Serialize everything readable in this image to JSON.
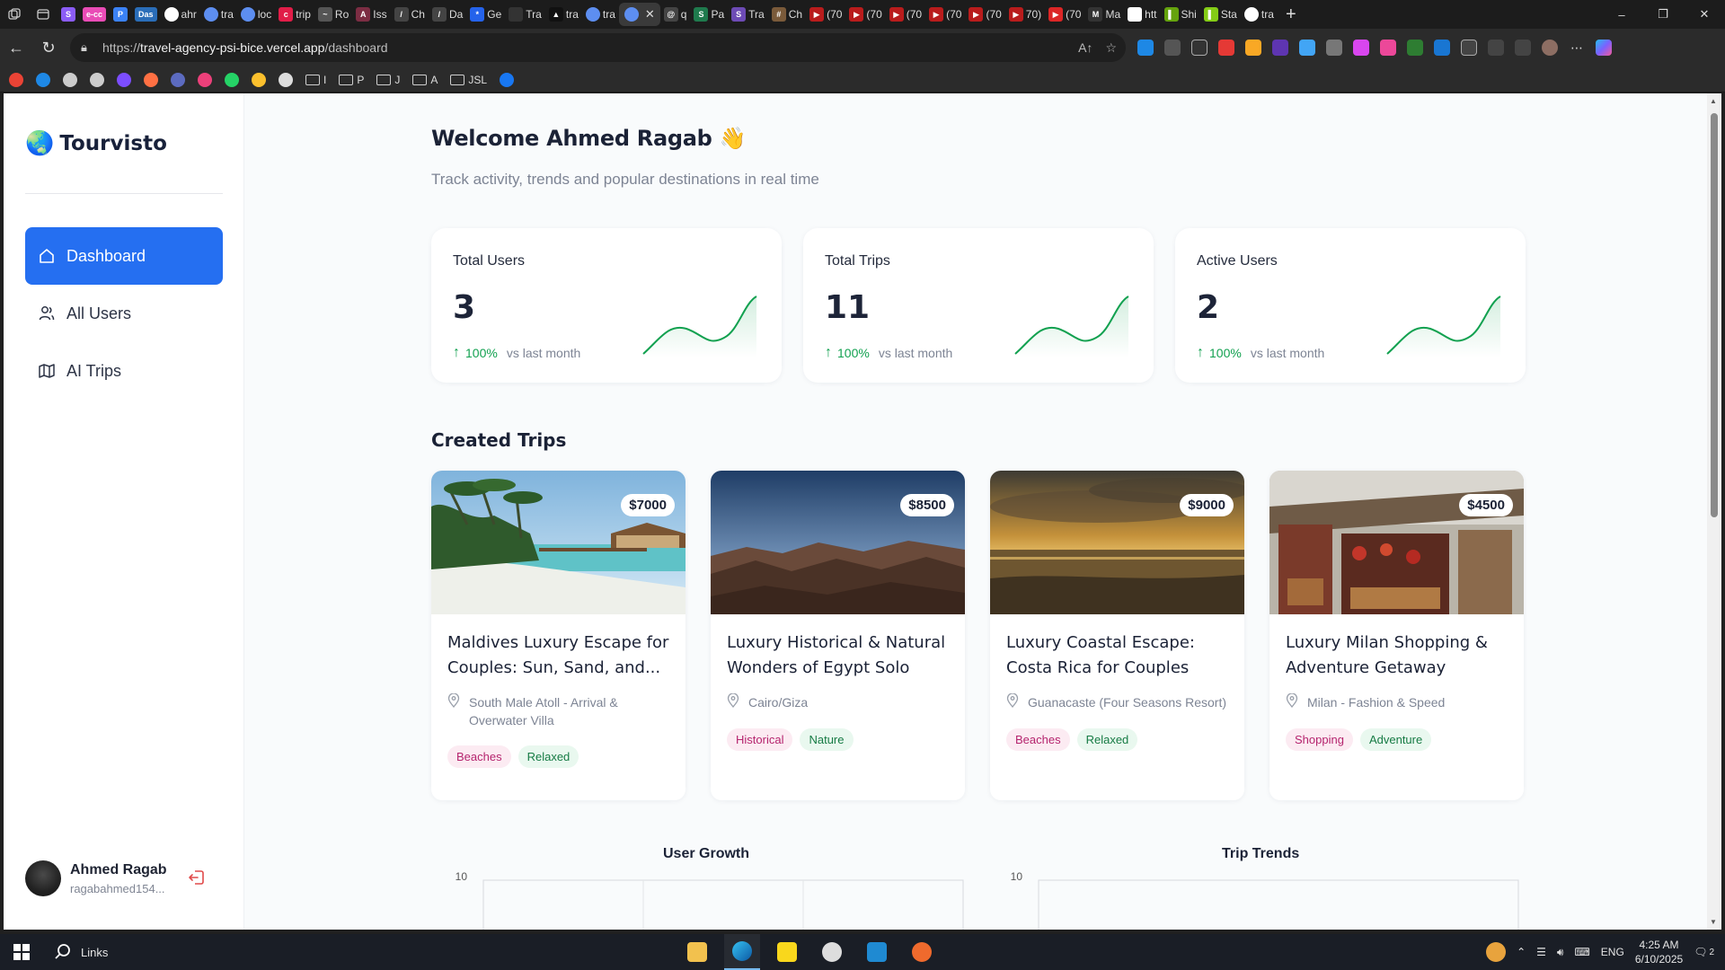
{
  "browser": {
    "tabs": [
      {
        "label": "",
        "favicon": "S",
        "color": "#8b5cf6"
      },
      {
        "label": "",
        "favicon": "e-cc",
        "color": "#e94cb6"
      },
      {
        "label": "",
        "favicon": "P",
        "color": "#3b82f6"
      },
      {
        "label": "",
        "favicon": "Das",
        "color": "#2a6db8"
      },
      {
        "label": "ahr",
        "favicon": "github-icon",
        "color": "#ffffff"
      },
      {
        "label": "tra",
        "favicon": "site-icon",
        "color": "#5d8ef0"
      },
      {
        "label": "loc",
        "favicon": "site-icon",
        "color": "#5d8ef0"
      },
      {
        "label": "trip",
        "favicon": "c",
        "color": "#e11d48"
      },
      {
        "label": "Ro",
        "favicon": "~",
        "color": "#555"
      },
      {
        "label": "Iss",
        "favicon": "A",
        "color": "#7c2d43"
      },
      {
        "label": "Ch",
        "favicon": "/",
        "color": "#444"
      },
      {
        "label": "Da",
        "favicon": "/",
        "color": "#444"
      },
      {
        "label": "Ge",
        "favicon": "*",
        "color": "#2563eb"
      },
      {
        "label": "Tra",
        "favicon": "",
        "color": "#333"
      },
      {
        "label": "tra",
        "favicon": "▲",
        "color": "#111"
      },
      {
        "label": "tra",
        "favicon": "site-icon",
        "color": "#5d8ef0"
      },
      {
        "label": "",
        "favicon": "site-icon",
        "color": "#5d8ef0",
        "active": true
      },
      {
        "label": "q",
        "favicon": "@",
        "color": "#444"
      },
      {
        "label": "Pa",
        "favicon": "S",
        "color": "#1f7a4d"
      },
      {
        "label": "Tra",
        "favicon": "S",
        "color": "#6d4bb5"
      },
      {
        "label": "Ch",
        "favicon": "#",
        "color": "#7a5a3a"
      },
      {
        "label": "(70",
        "favicon": "▶",
        "color": "#b91c1c"
      },
      {
        "label": "(70",
        "favicon": "▶",
        "color": "#b91c1c"
      },
      {
        "label": "(70",
        "favicon": "▶",
        "color": "#b91c1c"
      },
      {
        "label": "(70",
        "favicon": "▶",
        "color": "#b91c1c"
      },
      {
        "label": "(70",
        "favicon": "▶",
        "color": "#b91c1c"
      },
      {
        "label": "70)",
        "favicon": "▶",
        "color": "#b91c1c"
      },
      {
        "label": "(70",
        "favicon": "▶",
        "color": "#dc2626"
      },
      {
        "label": "Ma",
        "favicon": "M",
        "color": "#333"
      },
      {
        "label": "htt",
        "favicon": "G",
        "color": "#ffffff"
      },
      {
        "label": "Shi",
        "favicon": "▌",
        "color": "#65a30d"
      },
      {
        "label": "Sta",
        "favicon": "▌",
        "color": "#84cc16"
      },
      {
        "label": "tra",
        "favicon": "github-icon",
        "color": "#ffffff"
      }
    ],
    "url_prefix": "https://",
    "url_host": "travel-agency-psi-bice.vercel.app",
    "url_path": "/dashboard",
    "bookmarks": [
      {
        "label": "",
        "color": "#ea4335"
      },
      {
        "label": "",
        "color": "#1e88e5"
      },
      {
        "label": "",
        "color": "#cccccc"
      },
      {
        "label": "",
        "color": "#cccccc"
      },
      {
        "label": "",
        "color": "#7c4dff"
      },
      {
        "label": "",
        "color": "#ff7043"
      },
      {
        "label": "",
        "color": "#5c6bc0"
      },
      {
        "label": "",
        "color": "#ec407a"
      },
      {
        "label": "",
        "color": "#25d366"
      },
      {
        "label": "",
        "color": "#fbc02d"
      },
      {
        "label": "",
        "color": "#dddddd"
      },
      {
        "label": "I",
        "folder": true
      },
      {
        "label": "P",
        "folder": true
      },
      {
        "label": "J",
        "folder": true
      },
      {
        "label": "A",
        "folder": true
      },
      {
        "label": "JSL",
        "folder": true
      },
      {
        "label": "",
        "color": "#1877f2"
      }
    ]
  },
  "app": {
    "brand": "Tourvisto",
    "nav": [
      {
        "label": "Dashboard",
        "icon": "home-icon",
        "active": true
      },
      {
        "label": "All Users",
        "icon": "users-icon",
        "active": false
      },
      {
        "label": "AI Trips",
        "icon": "map-icon",
        "active": false
      }
    ],
    "user": {
      "name": "Ahmed Ragab",
      "email": "ragabahmed154..."
    }
  },
  "main": {
    "welcome": "Welcome Ahmed Ragab 👋",
    "subtitle": "Track activity, trends and popular destinations in real time",
    "stats": [
      {
        "label": "Total Users",
        "value": "3",
        "change": "100%",
        "compare": "vs last month"
      },
      {
        "label": "Total Trips",
        "value": "11",
        "change": "100%",
        "compare": "vs last month"
      },
      {
        "label": "Active Users",
        "value": "2",
        "change": "100%",
        "compare": "vs last month"
      }
    ],
    "trips_title": "Created Trips",
    "trips": [
      {
        "price": "$7000",
        "title": "Maldives Luxury Escape for Couples: Sun, Sand, and...",
        "location": "South Male Atoll - Arrival & Overwater Villa",
        "tags": [
          "Beaches",
          "Relaxed"
        ],
        "scene": "beach"
      },
      {
        "price": "$8500",
        "title": "Luxury Historical & Natural Wonders of Egypt Solo",
        "location": "Cairo/Giza",
        "tags": [
          "Historical",
          "Nature"
        ],
        "scene": "desert"
      },
      {
        "price": "$9000",
        "title": "Luxury Coastal Escape: Costa Rica for Couples",
        "location": "Guanacaste (Four Seasons Resort)",
        "tags": [
          "Beaches",
          "Relaxed"
        ],
        "scene": "sunset"
      },
      {
        "price": "$4500",
        "title": "Luxury Milan Shopping & Adventure Getaway",
        "location": "Milan - Fashion & Speed",
        "tags": [
          "Shopping",
          "Adventure"
        ],
        "scene": "market"
      }
    ],
    "charts": [
      {
        "title": "User Growth",
        "ymax_label": "10"
      },
      {
        "title": "Trip Trends",
        "ymax_label": "10"
      }
    ]
  },
  "taskbar": {
    "search_label": "Links",
    "language": "ENG",
    "time": "4:25 AM",
    "date": "6/10/2025",
    "notif_count": "2"
  }
}
